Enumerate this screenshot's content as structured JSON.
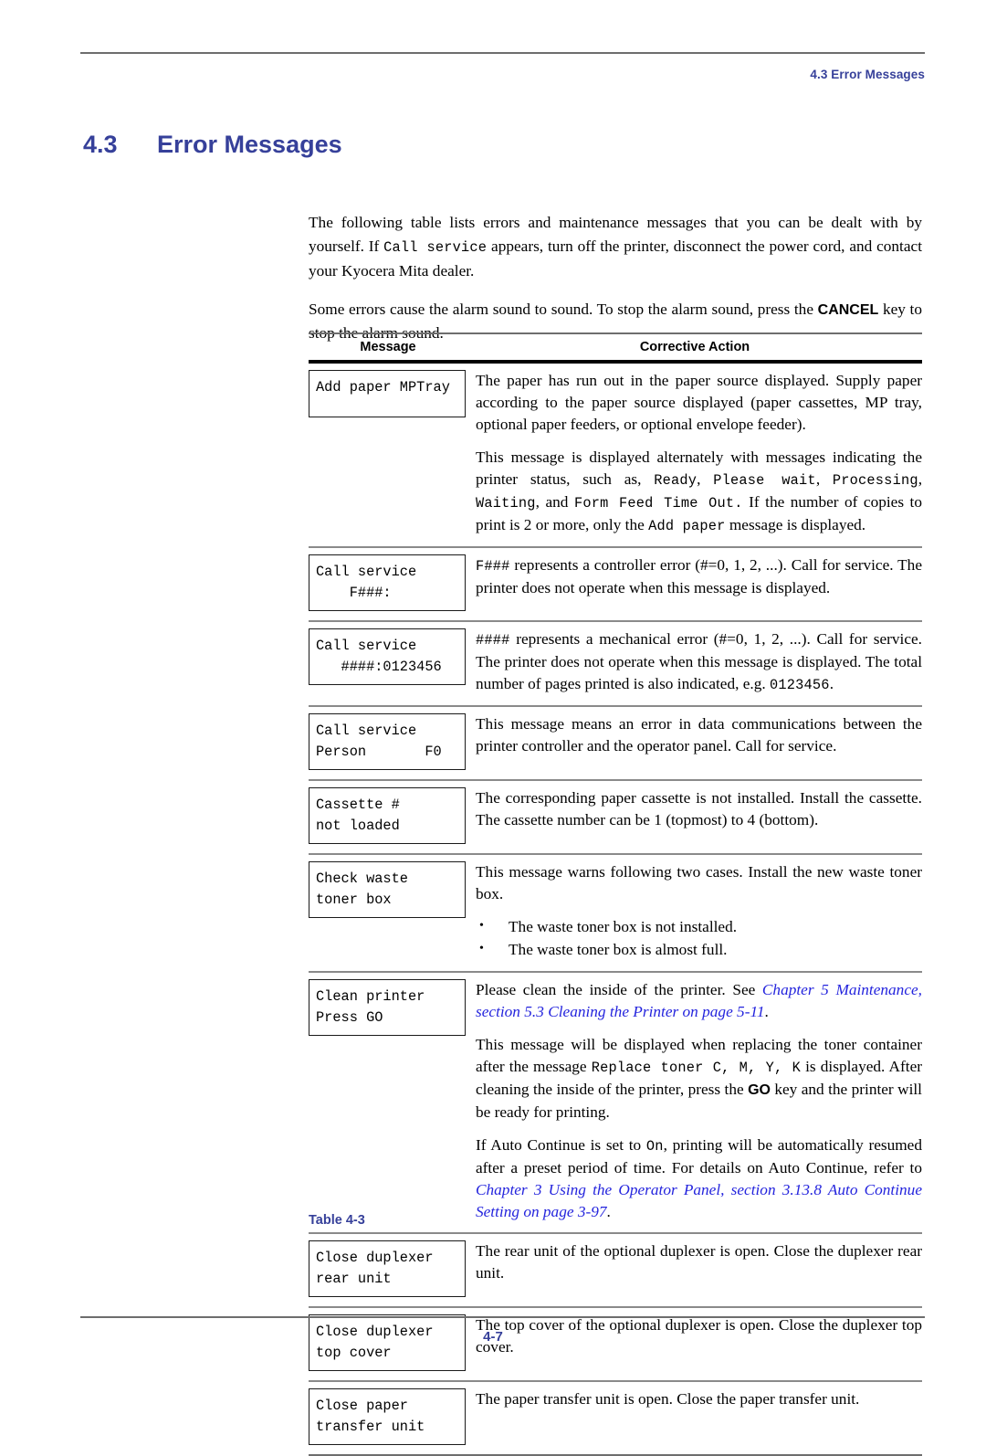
{
  "header": {
    "running_head": "4.3 Error Messages"
  },
  "section": {
    "number": "4.3",
    "title": "Error Messages"
  },
  "intro": {
    "p1_a": "The following table lists errors and maintenance messages that you can be dealt with by yourself. If ",
    "p1_code": "Call service",
    "p1_b": " appears, turn off the printer, disconnect the power cord, and contact your Kyocera Mita dealer.",
    "p2_a": "Some errors cause the alarm sound to sound. To stop the alarm sound, press the ",
    "p2_key": "CANCEL",
    "p2_b": " key to stop the alarm sound."
  },
  "table": {
    "columns": {
      "message": "Message",
      "action": "Corrective Action"
    },
    "rows": [
      {
        "message": "Add paper MPTray",
        "paragraphs": [
          {
            "segments": [
              {
                "text": "The paper has run out in the paper source displayed. Supply paper according to the paper source displayed (paper cassettes, MP tray, optional paper feeders, or optional envelope feeder)."
              }
            ]
          },
          {
            "segments": [
              {
                "text": "This message is displayed alternately with messages indicating the printer status, such as, "
              },
              {
                "text": "Ready",
                "style": "mono"
              },
              {
                "text": ", "
              },
              {
                "text": "Please wait",
                "style": "mono"
              },
              {
                "text": ", "
              },
              {
                "text": "Processing",
                "style": "mono"
              },
              {
                "text": ", "
              },
              {
                "text": "Waiting",
                "style": "mono"
              },
              {
                "text": ", and "
              },
              {
                "text": "Form Feed Time Out.",
                "style": "mono"
              },
              {
                "text": " If the number of copies to print is 2 or more, only the "
              },
              {
                "text": "Add paper",
                "style": "mono"
              },
              {
                "text": " message is displayed."
              }
            ]
          }
        ]
      },
      {
        "message": "Call service\n    F###:",
        "paragraphs": [
          {
            "segments": [
              {
                "text": "F###",
                "style": "mono"
              },
              {
                "text": " represents a controller error (#=0, 1, 2, ...). Call for service. The printer does not operate when this message is displayed."
              }
            ]
          }
        ]
      },
      {
        "message": "Call service\n   ####:0123456",
        "paragraphs": [
          {
            "segments": [
              {
                "text": "####",
                "style": "mono"
              },
              {
                "text": " represents a mechanical error (#=0, 1, 2, ...). Call for service. The printer does not operate when this message is displayed. The total number of pages printed is also indicated, e.g. "
              },
              {
                "text": "0123456",
                "style": "mono"
              },
              {
                "text": "."
              }
            ]
          }
        ]
      },
      {
        "message": "Call service\nPerson       F0",
        "paragraphs": [
          {
            "segments": [
              {
                "text": "This message means an error in data communications between the printer controller and the operator panel. Call for service."
              }
            ]
          }
        ]
      },
      {
        "message": "Cassette #\nnot loaded",
        "paragraphs": [
          {
            "segments": [
              {
                "text": "The corresponding paper cassette is not installed. Install the cassette. The cassette number can be 1 (topmost) to 4 (bottom)."
              }
            ]
          }
        ]
      },
      {
        "message": "Check waste\ntoner box",
        "paragraphs": [
          {
            "segments": [
              {
                "text": "This message warns following two cases. Install the new waste toner box."
              }
            ]
          }
        ],
        "bullets": [
          "The waste toner box is not installed.",
          "The waste toner box is almost full."
        ]
      },
      {
        "message": "Clean printer\nPress GO",
        "paragraphs": [
          {
            "segments": [
              {
                "text": "Please clean the inside of the printer. See "
              },
              {
                "text": "Chapter 5 Maintenance, section 5.3 Cleaning the Printer on page 5-11",
                "style": "link"
              },
              {
                "text": "."
              }
            ]
          },
          {
            "segments": [
              {
                "text": "This message will be displayed when replacing the toner container after the message "
              },
              {
                "text": "Replace toner C, M, Y, K",
                "style": "mono"
              },
              {
                "text": " is displayed. After cleaning the inside of the printer, press the "
              },
              {
                "text": "GO",
                "style": "key"
              },
              {
                "text": " key and the printer will be ready for printing."
              }
            ]
          },
          {
            "segments": [
              {
                "text": "If Auto Continue is set to "
              },
              {
                "text": "On",
                "style": "mono"
              },
              {
                "text": ", printing will be automatically resumed after a preset period of time. For details on Auto Continue, refer to "
              },
              {
                "text": "Chapter 3 Using the Operator Panel, section 3.13.8 Auto Continue Setting on page 3-97",
                "style": "link"
              },
              {
                "text": "."
              }
            ]
          }
        ]
      },
      {
        "message": "Close duplexer\nrear unit",
        "paragraphs": [
          {
            "segments": [
              {
                "text": "The rear unit of the optional duplexer is open. Close the duplexer rear unit."
              }
            ]
          }
        ]
      },
      {
        "message": "Close duplexer\ntop cover",
        "paragraphs": [
          {
            "segments": [
              {
                "text": "The top cover of the optional duplexer is open. Close the duplexer top cover."
              }
            ]
          }
        ]
      },
      {
        "message": "Close paper\ntransfer unit",
        "paragraphs": [
          {
            "segments": [
              {
                "text": "The paper transfer unit is open. Close the paper transfer unit."
              }
            ]
          }
        ]
      }
    ]
  },
  "caption": "Table 4-3",
  "footer": {
    "page_number": "4-7"
  },
  "colors": {
    "heading_blue": "#36409a",
    "link_blue": "#2424dd",
    "rule_gray": "#6d6d6d",
    "row_separator": "#8a8a8a"
  }
}
